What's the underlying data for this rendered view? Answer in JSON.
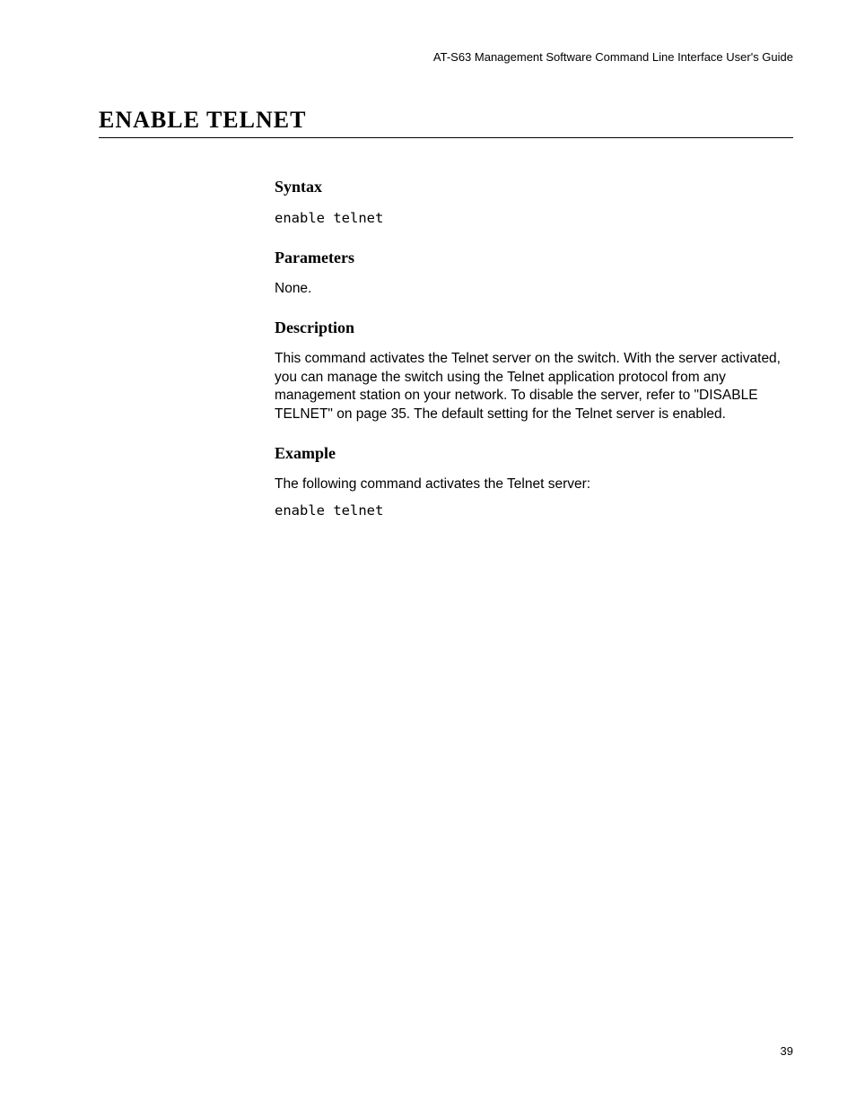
{
  "header": {
    "guide_title": "AT-S63 Management Software Command Line Interface User's Guide"
  },
  "title": "ENABLE TELNET",
  "sections": {
    "syntax": {
      "heading": "Syntax",
      "code": "enable telnet"
    },
    "parameters": {
      "heading": "Parameters",
      "text": "None."
    },
    "description": {
      "heading": "Description",
      "text": "This command activates the Telnet server on the switch. With the server activated, you can manage the switch using the Telnet application protocol from any management station on your network. To disable the server, refer to \"DISABLE TELNET\" on page 35. The default setting for the Telnet server is enabled."
    },
    "example": {
      "heading": "Example",
      "text": "The following command activates the Telnet server:",
      "code": "enable telnet"
    }
  },
  "page_number": "39"
}
